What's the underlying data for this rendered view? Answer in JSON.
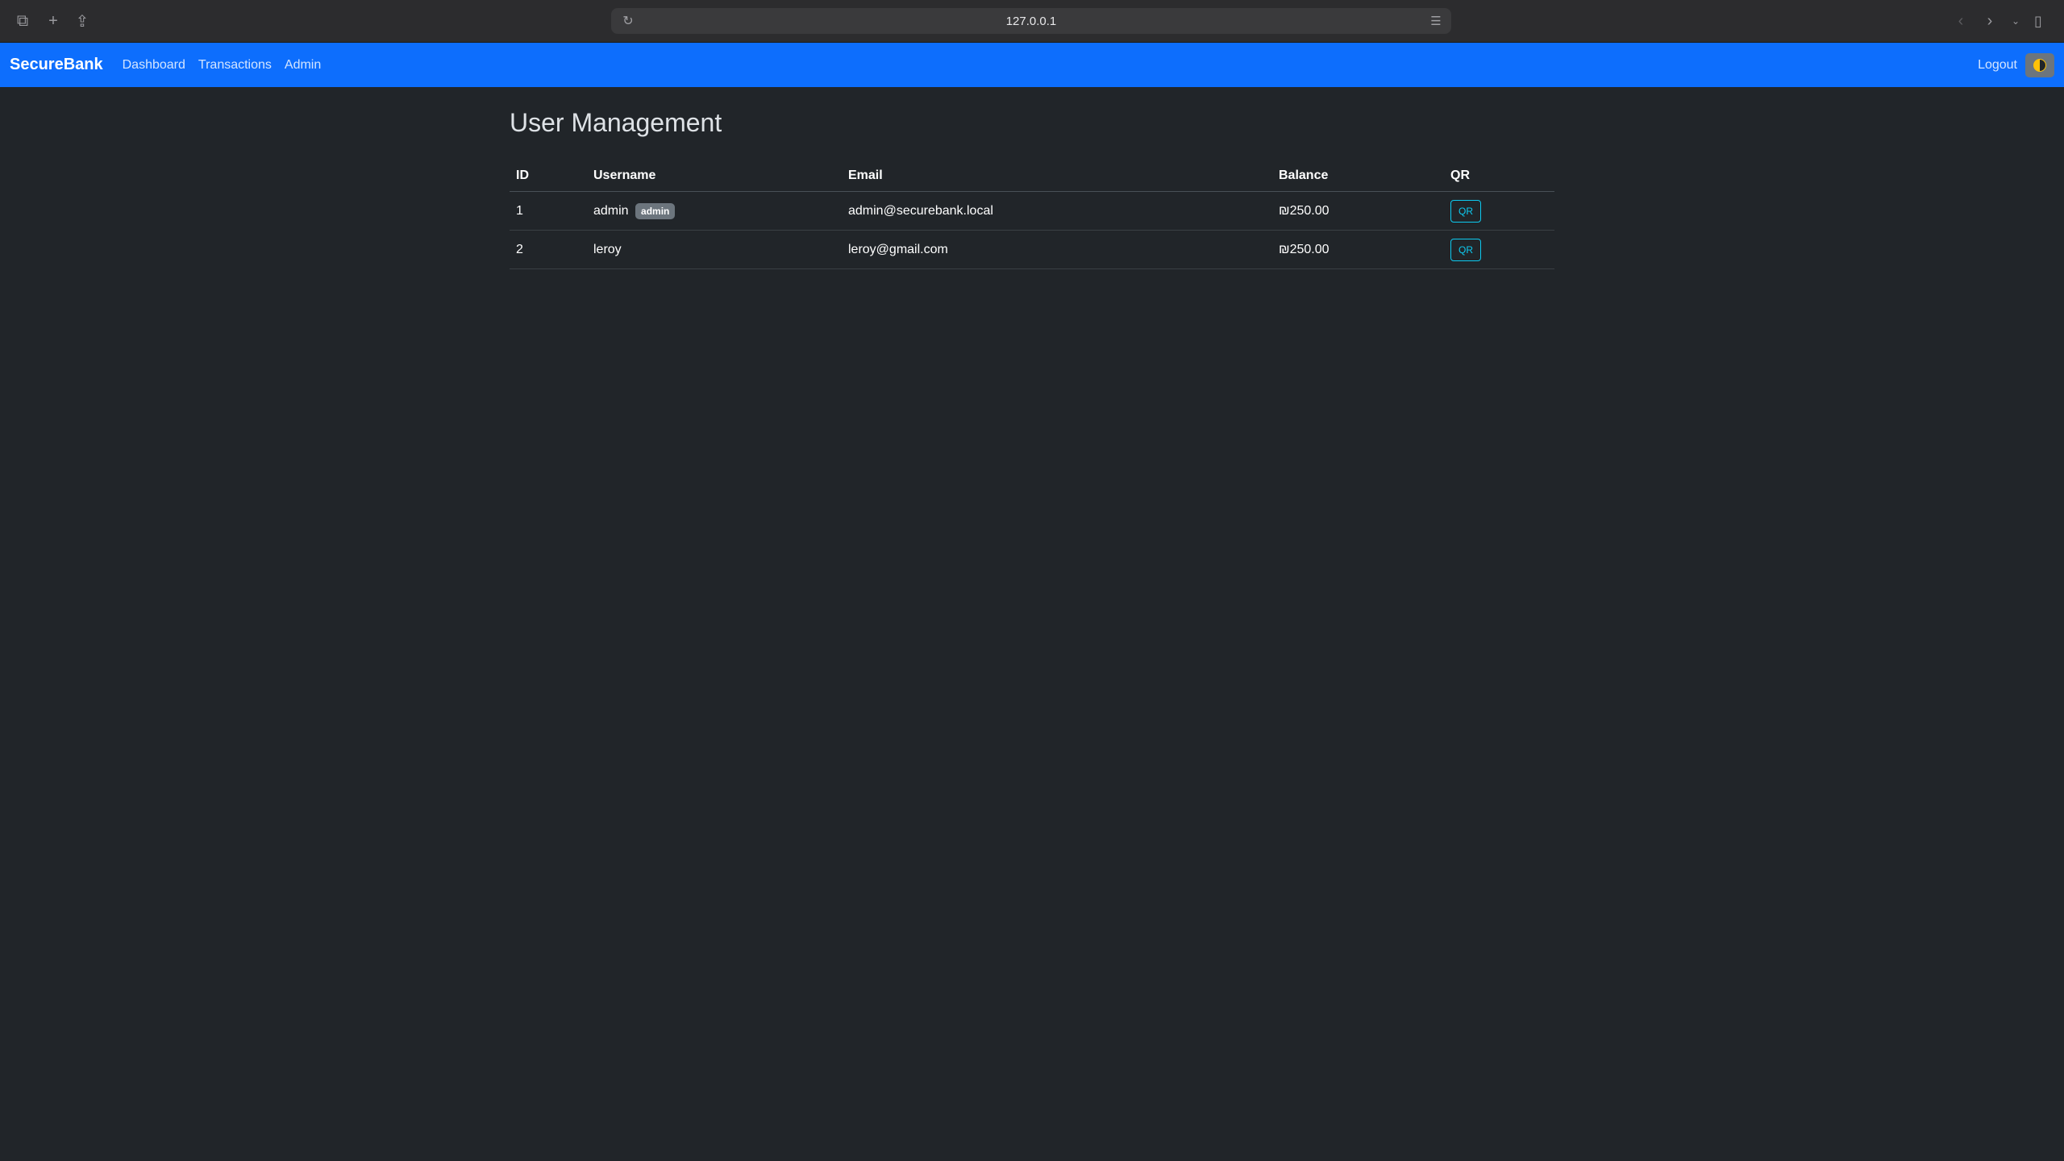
{
  "browser": {
    "url": "127.0.0.1"
  },
  "navbar": {
    "brand": "SecureBank",
    "links": [
      "Dashboard",
      "Transactions",
      "Admin"
    ],
    "logout": "Logout",
    "accent_color": "#0d6efd"
  },
  "page": {
    "title": "User Management"
  },
  "table": {
    "headers": [
      "ID",
      "Username",
      "Email",
      "Balance",
      "QR"
    ],
    "rows": [
      {
        "id": "1",
        "username": "admin",
        "badge": "admin",
        "email": "admin@securebank.local",
        "balance": "₪250.00",
        "qr": "QR"
      },
      {
        "id": "2",
        "username": "leroy",
        "badge": "",
        "email": "leroy@gmail.com",
        "balance": "₪250.00",
        "qr": "QR"
      }
    ]
  }
}
